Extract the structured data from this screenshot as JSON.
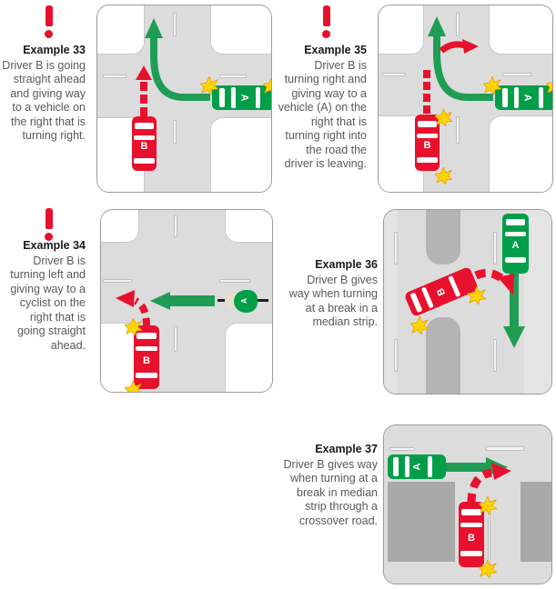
{
  "document": {
    "kind": "road-rules-give-way-examples",
    "alert_icon": "exclamation-mark-icon",
    "colors": {
      "alert_red": "#e8112d",
      "vehicle_red": "#e8112d",
      "vehicle_green": "#009e49",
      "road_gray": "#dcdcdc",
      "median_gray": "#b4b4b4",
      "building_gray": "#a9a9a9",
      "indicator_yellow": "#ffd400",
      "title_text": "#1a1a1a",
      "body_text": "#58595b"
    }
  },
  "examples": [
    {
      "id": "example-33",
      "title": "Example 33",
      "body": "Driver B is going straight ahead and giving way to a vehicle on the right that is turning right.",
      "has_alert": true,
      "scene": {
        "type": "four-way-intersection",
        "vehicles": [
          {
            "label": "B",
            "color": "red",
            "heading": "north",
            "role": "giving-way"
          },
          {
            "label": "A",
            "color": "green",
            "heading": "west",
            "role": "turning-right"
          }
        ],
        "arrows": [
          {
            "color": "red",
            "style": "dashed",
            "path": "straight-ahead-north",
            "belongs_to": "B"
          },
          {
            "color": "green",
            "style": "solid",
            "path": "right-turn-west-to-north",
            "belongs_to": "A"
          }
        ],
        "indicators": 2
      }
    },
    {
      "id": "example-34",
      "title": "Example 34",
      "body": "Driver B is turning left and giving way to a cyclist on the right that is going straight ahead.",
      "has_alert": true,
      "scene": {
        "type": "four-way-intersection",
        "vehicles": [
          {
            "label": "B",
            "color": "red",
            "heading": "north",
            "role": "turning-left"
          },
          {
            "label": "A",
            "color": "green",
            "heading": "west",
            "role": "cyclist-straight-ahead",
            "is_cyclist": true
          }
        ],
        "arrows": [
          {
            "color": "red",
            "style": "dashed",
            "path": "left-turn-north-to-west",
            "belongs_to": "B"
          },
          {
            "color": "green",
            "style": "solid",
            "path": "straight-ahead-west",
            "belongs_to": "cyclist"
          }
        ],
        "indicators": 2
      }
    },
    {
      "id": "example-35",
      "title": "Example 35",
      "body": "Driver B is turning right and giving way to a vehicle (A) on the right that is turning right into the road the driver is leaving.",
      "has_alert": true,
      "scene": {
        "type": "four-way-intersection",
        "vehicles": [
          {
            "label": "B",
            "color": "red",
            "heading": "north",
            "role": "turning-right"
          },
          {
            "label": "A",
            "color": "green",
            "heading": "west",
            "role": "turning-right"
          }
        ],
        "arrows": [
          {
            "color": "red",
            "style": "dashed",
            "path": "approach-north",
            "belongs_to": "B"
          },
          {
            "color": "red",
            "style": "solid",
            "path": "right-turn-east",
            "belongs_to": "B"
          },
          {
            "color": "green",
            "style": "solid",
            "path": "right-turn-west-to-north",
            "belongs_to": "A"
          }
        ],
        "indicators": 3
      }
    },
    {
      "id": "example-36",
      "title": "Example 36",
      "body": "Driver B gives way when turning at a break in a median strip.",
      "has_alert": false,
      "scene": {
        "type": "divided-road-median-break",
        "vehicles": [
          {
            "label": "B",
            "color": "red",
            "heading": "north-east-diagonal",
            "role": "turning-through-median-break"
          },
          {
            "label": "A",
            "color": "green",
            "heading": "south",
            "role": "has-right-of-way"
          }
        ],
        "arrows": [
          {
            "color": "red",
            "style": "dashed",
            "path": "curve-into-right-lane",
            "belongs_to": "B"
          },
          {
            "color": "green",
            "style": "solid",
            "path": "straight-ahead-south",
            "belongs_to": "A"
          }
        ],
        "indicators": 2
      }
    },
    {
      "id": "example-37",
      "title": "Example 37",
      "body": "Driver B gives way when turning at a break in median strip through a crossover road.",
      "has_alert": false,
      "scene": {
        "type": "crossover-road-median-break",
        "vehicles": [
          {
            "label": "B",
            "color": "red",
            "heading": "north",
            "role": "turning-through-median-break"
          },
          {
            "label": "A",
            "color": "green",
            "heading": "east",
            "role": "has-right-of-way"
          }
        ],
        "arrows": [
          {
            "color": "red",
            "style": "dashed",
            "path": "curve-right-into-road",
            "belongs_to": "B"
          },
          {
            "color": "green",
            "style": "solid",
            "path": "straight-ahead-east",
            "belongs_to": "A"
          }
        ],
        "indicators": 2
      }
    }
  ]
}
